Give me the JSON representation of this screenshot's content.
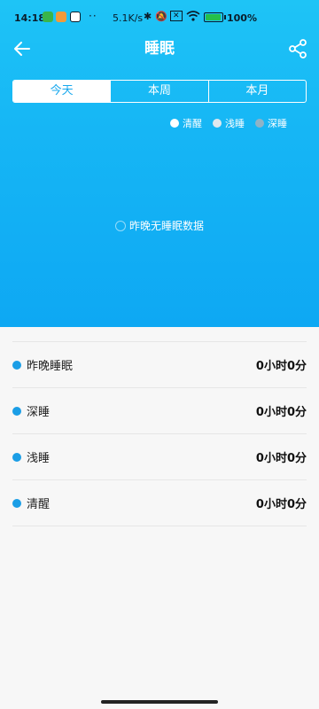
{
  "status_bar": {
    "time": "14:18",
    "network_speed": "5.1K/s",
    "battery_percent": "100%",
    "battery_level": 1.0,
    "icons": [
      "wechat-icon",
      "notify-icon",
      "k-app-icon",
      "bluetooth-icon",
      "mute-icon",
      "sim-icon",
      "wifi-icon",
      "battery-icon"
    ]
  },
  "header": {
    "title": "睡眠",
    "back_icon": "arrow-left-icon",
    "share_icon": "share-icon"
  },
  "tabs": [
    {
      "label": "今天",
      "active": true
    },
    {
      "label": "本周",
      "active": false
    },
    {
      "label": "本月",
      "active": false
    }
  ],
  "legend": [
    {
      "label": "清醒",
      "color": "#ffffff"
    },
    {
      "label": "浅睡",
      "color": "#dfe8ee"
    },
    {
      "label": "深睡",
      "color": "#8fb3c6"
    }
  ],
  "empty_message": "昨晚无睡眠数据",
  "stats": [
    {
      "label": "昨晚睡眠",
      "value": "0小时0分"
    },
    {
      "label": "深睡",
      "value": "0小时0分"
    },
    {
      "label": "浅睡",
      "value": "0小时0分"
    },
    {
      "label": "清醒",
      "value": "0小时0分"
    }
  ],
  "colors": {
    "accent": "#16b6f5",
    "stat_dot": "#1b9ee6",
    "active_tab_text": "#1aa9ee"
  }
}
